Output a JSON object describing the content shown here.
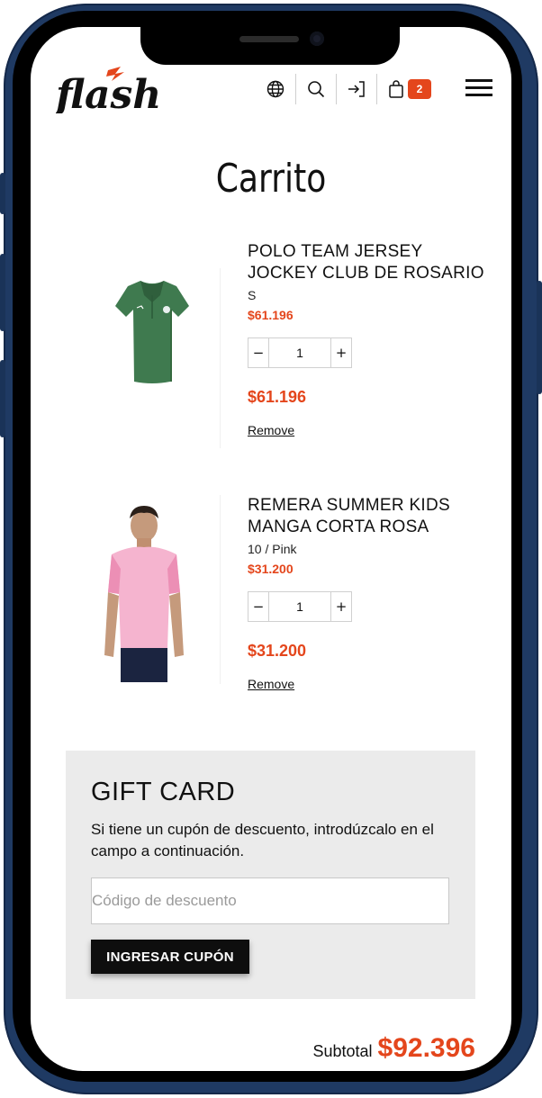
{
  "header": {
    "logo_text": "flash",
    "icons": [
      "globe-icon",
      "search-icon",
      "login-icon",
      "cart-icon",
      "menu-icon"
    ],
    "cart_count": "2"
  },
  "page": {
    "title": "Carrito"
  },
  "cart": {
    "items": [
      {
        "title": "POLO TEAM JERSEY JOCKEY CLUB DE ROSARIO",
        "variant": "S",
        "unit_price": "$61.196",
        "qty_minus": "−",
        "quantity": "1",
        "qty_plus": "+",
        "line_total": "$61.196",
        "remove_label": "Remove"
      },
      {
        "title": "REMERA SUMMER KIDS MANGA CORTA ROSA",
        "variant": "10 / Pink",
        "unit_price": "$31.200",
        "qty_minus": "−",
        "quantity": "1",
        "qty_plus": "+",
        "line_total": "$31.200",
        "remove_label": "Remove"
      }
    ]
  },
  "gift_card": {
    "title": "GIFT CARD",
    "text": "Si tiene un cupón de descuento, introdúzcalo en el campo a continuación.",
    "input_placeholder": "Código de descuento",
    "button_label": "INGRESAR CUPÓN"
  },
  "summary": {
    "subtotal_label": "Subtotal",
    "subtotal_value": "$92.396"
  },
  "colors": {
    "accent": "#e4461c",
    "frame": "#1f3a63",
    "gift_bg": "#ebebeb",
    "button_bg": "#0e0e0e"
  }
}
